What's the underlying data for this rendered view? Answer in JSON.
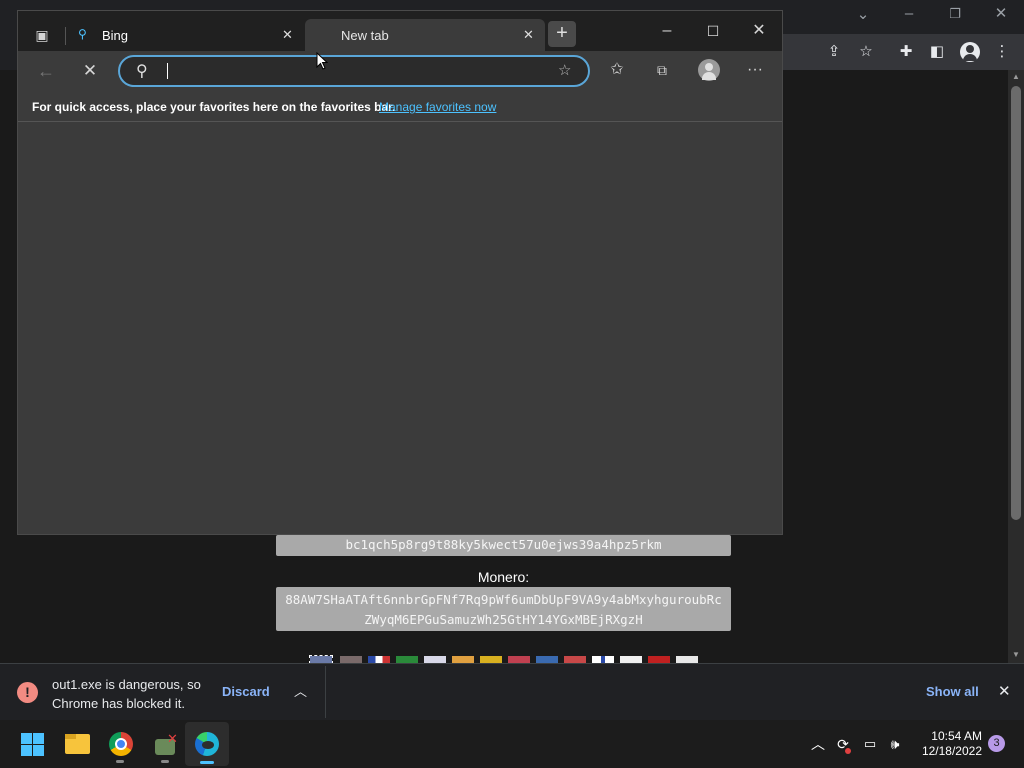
{
  "edge": {
    "tabs": [
      {
        "label": "Bing"
      },
      {
        "label": "New tab"
      }
    ],
    "address_value": "",
    "favbar_text": "For quick access, place your favorites here on the favorites bar.",
    "favbar_link": "Manage favorites now"
  },
  "page": {
    "btc_address": "bc1qch5p8rg9t88ky5kwect57u0ejws39a4hpz5rkm",
    "monero_label": "Monero:",
    "monero_address_line1": "88AW7SHaATAft6nnbrGpFNf7Rq9pWf6umDbUpF9VA9y4abMxyhguroubRc",
    "monero_address_line2": "ZWyqM6EPGuSamuzWh25GtHY14YGxMBEjRXgzH"
  },
  "download": {
    "message_line1": "out1.exe is dangerous, so",
    "message_line2": "Chrome has blocked it.",
    "discard_label": "Discard",
    "show_all_label": "Show all"
  },
  "taskbar": {
    "time": "10:54 AM",
    "date": "12/18/2022",
    "notification_count": "3"
  },
  "colors": {
    "edge_accent": "#5aa6d8",
    "link": "#4cc2ff",
    "danger": "#f28b82",
    "chrome_blue": "#8ab4f8"
  }
}
